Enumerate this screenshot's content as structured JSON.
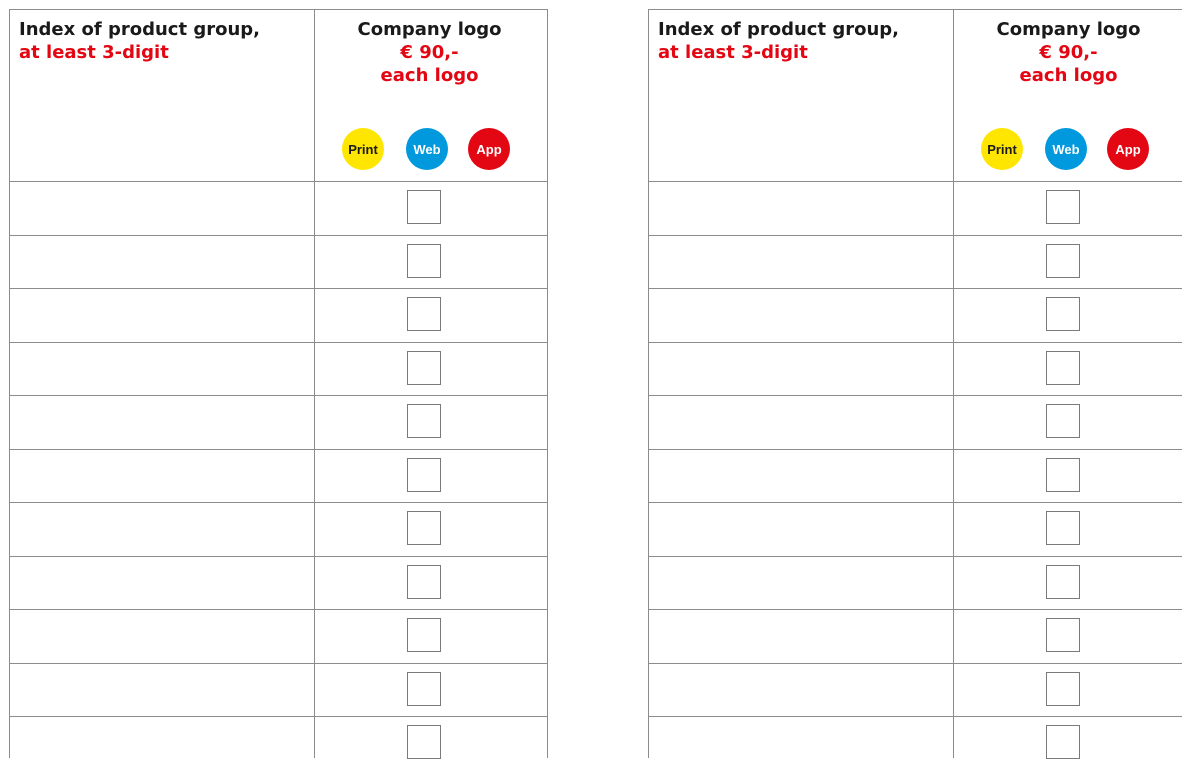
{
  "columns": [
    {
      "index_header": {
        "line1": "Index of product group,",
        "line2": "at least 3-digit"
      },
      "logo_header": {
        "title": "Company logo",
        "price": "€ 90,-",
        "per": "each logo"
      },
      "badges": [
        {
          "label": "Print",
          "color": "#ffe600"
        },
        {
          "label": "Web",
          "color": "#0099dd"
        },
        {
          "label": "App",
          "color": "#e30613"
        }
      ],
      "rows": [
        {
          "index": "",
          "checked": false
        },
        {
          "index": "",
          "checked": false
        },
        {
          "index": "",
          "checked": false
        },
        {
          "index": "",
          "checked": false
        },
        {
          "index": "",
          "checked": false
        },
        {
          "index": "",
          "checked": false
        },
        {
          "index": "",
          "checked": false
        },
        {
          "index": "",
          "checked": false
        },
        {
          "index": "",
          "checked": false
        },
        {
          "index": "",
          "checked": false
        },
        {
          "index": "",
          "checked": false
        }
      ]
    },
    {
      "index_header": {
        "line1": "Index of product group,",
        "line2": "at least 3-digit"
      },
      "logo_header": {
        "title": "Company logo",
        "price": "€ 90,-",
        "per": "each logo"
      },
      "badges": [
        {
          "label": "Print",
          "color": "#ffe600"
        },
        {
          "label": "Web",
          "color": "#0099dd"
        },
        {
          "label": "App",
          "color": "#e30613"
        }
      ],
      "rows": [
        {
          "index": "",
          "checked": false
        },
        {
          "index": "",
          "checked": false
        },
        {
          "index": "",
          "checked": false
        },
        {
          "index": "",
          "checked": false
        },
        {
          "index": "",
          "checked": false
        },
        {
          "index": "",
          "checked": false
        },
        {
          "index": "",
          "checked": false
        },
        {
          "index": "",
          "checked": false
        },
        {
          "index": "",
          "checked": false
        },
        {
          "index": "",
          "checked": false
        },
        {
          "index": "",
          "checked": false
        }
      ]
    }
  ],
  "colors": {
    "accent_red": "#e30613",
    "border_gray": "#8c8c8c"
  }
}
